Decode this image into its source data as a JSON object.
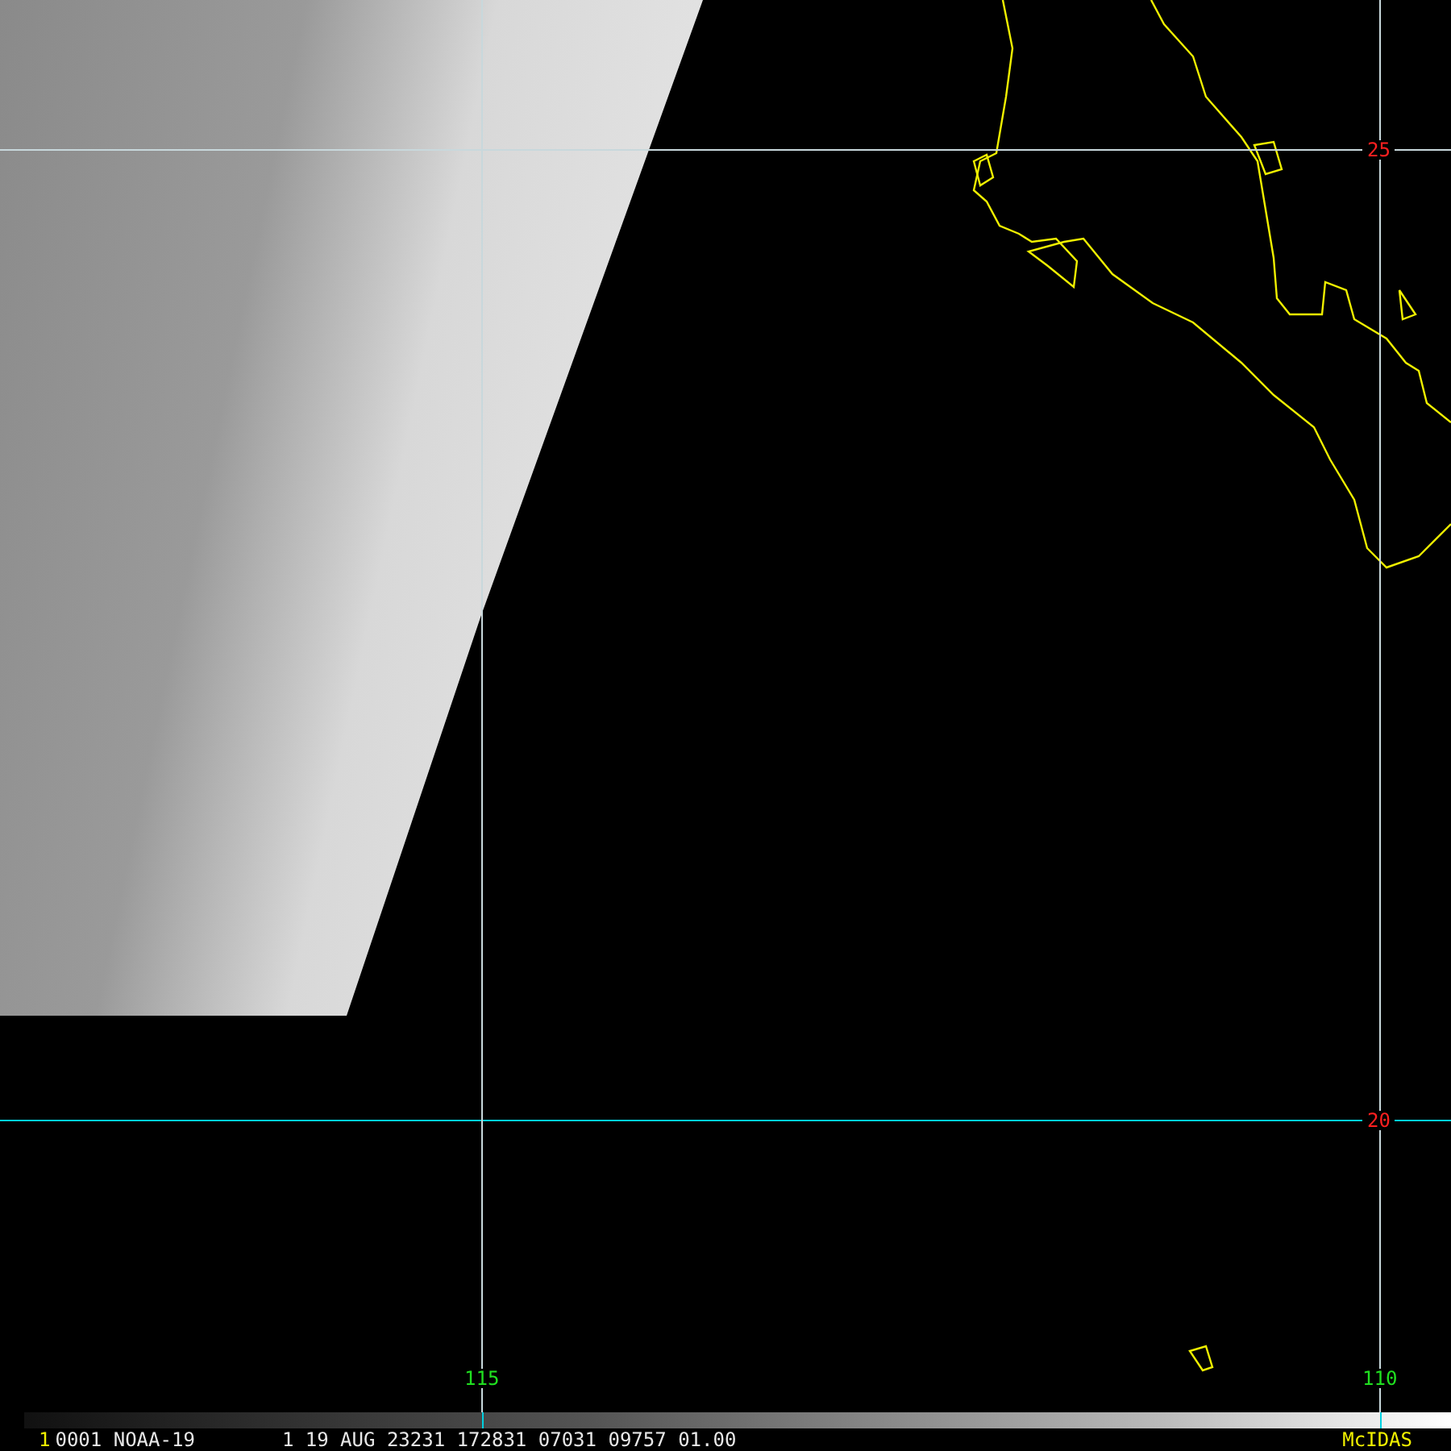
{
  "map": {
    "latitude_labels": [
      "25",
      "20"
    ],
    "longitude_labels": [
      "115",
      "110"
    ]
  },
  "status_bar": {
    "frame": "1",
    "fields": [
      "0001 NOAA-19",
      "1 19 AUG 23231 172831 07031 09757 01.00"
    ],
    "brand": "McIDAS"
  }
}
